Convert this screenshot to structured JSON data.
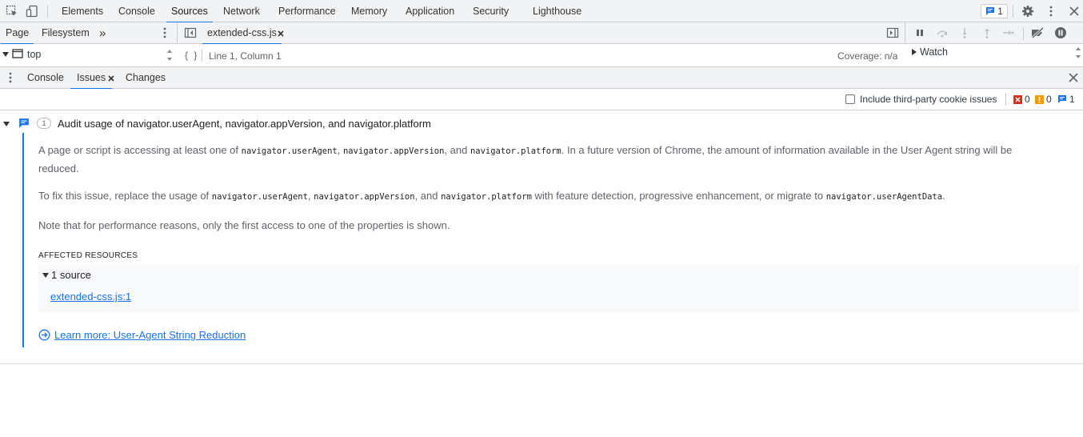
{
  "main_tabs": [
    {
      "label": "Elements"
    },
    {
      "label": "Console"
    },
    {
      "label": "Sources",
      "active": true
    },
    {
      "label": "Network"
    },
    {
      "label": "Performance"
    },
    {
      "label": "Memory"
    },
    {
      "label": "Application"
    },
    {
      "label": "Security"
    },
    {
      "label": "Lighthouse"
    }
  ],
  "issues_counter": {
    "count": "1",
    "icon": "message-icon"
  },
  "icons": {
    "inspect": "inspect-element-icon",
    "device": "device-toolbar-icon",
    "settings": "gear-icon",
    "more": "kebab-icon",
    "close": "close-icon"
  },
  "navigator": {
    "tabs": [
      {
        "label": "Page",
        "active": true
      },
      {
        "label": "Filesystem"
      }
    ],
    "overflow": "»",
    "frame": "top"
  },
  "editor": {
    "file_tab": "extended-css.js",
    "format_button": "{ }",
    "cursor": "Line 1, Column 1",
    "coverage": "Coverage: n/a"
  },
  "debugger": {
    "watch_label": "Watch"
  },
  "drawer": {
    "tabs": [
      {
        "label": "Console"
      },
      {
        "label": "Issues",
        "active": true,
        "closable": true
      },
      {
        "label": "Changes"
      }
    ]
  },
  "issues_toolbar": {
    "third_party_label": "Include third-party cookie issues",
    "third_party_checked": false,
    "counts": [
      {
        "kind": "error",
        "value": "0",
        "color": "#d93025"
      },
      {
        "kind": "warning",
        "value": "0",
        "color": "#f29900"
      },
      {
        "kind": "info",
        "value": "1",
        "color": "#1a73e8"
      }
    ]
  },
  "issue": {
    "badge": "1",
    "title": "Audit usage of navigator.userAgent, navigator.appVersion, and navigator.platform",
    "p1": {
      "t1": "A page or script is accessing at least one of ",
      "c1": "navigator.userAgent",
      "t2": ", ",
      "c2": "navigator.appVersion",
      "t3": ", and ",
      "c3": "navigator.platform",
      "t4": ". In a future version of Chrome, the amount of information available in the User Agent string will be",
      "t5": "reduced."
    },
    "p2": {
      "t1": "To fix this issue, replace the usage of ",
      "c1": "navigator.userAgent",
      "t2": ", ",
      "c2": "navigator.appVersion",
      "t3": ", and ",
      "c3": "navigator.platform",
      "t4": " with feature detection, progressive enhancement, or migrate to ",
      "c4": "navigator.userAgentData",
      "t5": "."
    },
    "p3": "Note that for performance reasons, only the first access to one of the properties is shown.",
    "affected_label": "AFFECTED RESOURCES",
    "source_count": "1 source",
    "source_link": "extended-css.js:1",
    "learn_more": "Learn more: User-Agent String Reduction"
  },
  "colors": {
    "accent": "#1a73e8",
    "toolbar_bg": "#f1f3f4",
    "border": "#cbcdd1"
  }
}
